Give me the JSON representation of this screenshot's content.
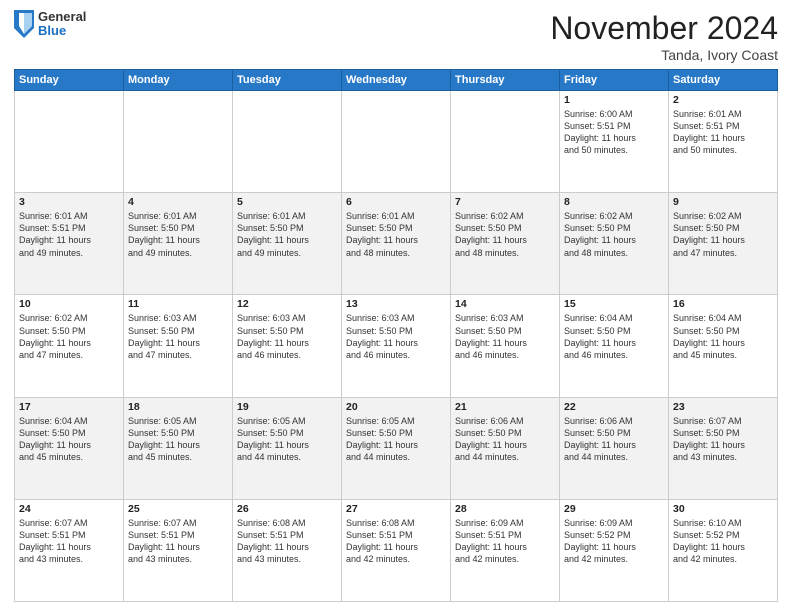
{
  "header": {
    "logo_general": "General",
    "logo_blue": "Blue",
    "month": "November 2024",
    "location": "Tanda, Ivory Coast"
  },
  "weekdays": [
    "Sunday",
    "Monday",
    "Tuesday",
    "Wednesday",
    "Thursday",
    "Friday",
    "Saturday"
  ],
  "weeks": [
    [
      {
        "day": "",
        "info": ""
      },
      {
        "day": "",
        "info": ""
      },
      {
        "day": "",
        "info": ""
      },
      {
        "day": "",
        "info": ""
      },
      {
        "day": "",
        "info": ""
      },
      {
        "day": "1",
        "info": "Sunrise: 6:00 AM\nSunset: 5:51 PM\nDaylight: 11 hours\nand 50 minutes."
      },
      {
        "day": "2",
        "info": "Sunrise: 6:01 AM\nSunset: 5:51 PM\nDaylight: 11 hours\nand 50 minutes."
      }
    ],
    [
      {
        "day": "3",
        "info": "Sunrise: 6:01 AM\nSunset: 5:51 PM\nDaylight: 11 hours\nand 49 minutes."
      },
      {
        "day": "4",
        "info": "Sunrise: 6:01 AM\nSunset: 5:50 PM\nDaylight: 11 hours\nand 49 minutes."
      },
      {
        "day": "5",
        "info": "Sunrise: 6:01 AM\nSunset: 5:50 PM\nDaylight: 11 hours\nand 49 minutes."
      },
      {
        "day": "6",
        "info": "Sunrise: 6:01 AM\nSunset: 5:50 PM\nDaylight: 11 hours\nand 48 minutes."
      },
      {
        "day": "7",
        "info": "Sunrise: 6:02 AM\nSunset: 5:50 PM\nDaylight: 11 hours\nand 48 minutes."
      },
      {
        "day": "8",
        "info": "Sunrise: 6:02 AM\nSunset: 5:50 PM\nDaylight: 11 hours\nand 48 minutes."
      },
      {
        "day": "9",
        "info": "Sunrise: 6:02 AM\nSunset: 5:50 PM\nDaylight: 11 hours\nand 47 minutes."
      }
    ],
    [
      {
        "day": "10",
        "info": "Sunrise: 6:02 AM\nSunset: 5:50 PM\nDaylight: 11 hours\nand 47 minutes."
      },
      {
        "day": "11",
        "info": "Sunrise: 6:03 AM\nSunset: 5:50 PM\nDaylight: 11 hours\nand 47 minutes."
      },
      {
        "day": "12",
        "info": "Sunrise: 6:03 AM\nSunset: 5:50 PM\nDaylight: 11 hours\nand 46 minutes."
      },
      {
        "day": "13",
        "info": "Sunrise: 6:03 AM\nSunset: 5:50 PM\nDaylight: 11 hours\nand 46 minutes."
      },
      {
        "day": "14",
        "info": "Sunrise: 6:03 AM\nSunset: 5:50 PM\nDaylight: 11 hours\nand 46 minutes."
      },
      {
        "day": "15",
        "info": "Sunrise: 6:04 AM\nSunset: 5:50 PM\nDaylight: 11 hours\nand 46 minutes."
      },
      {
        "day": "16",
        "info": "Sunrise: 6:04 AM\nSunset: 5:50 PM\nDaylight: 11 hours\nand 45 minutes."
      }
    ],
    [
      {
        "day": "17",
        "info": "Sunrise: 6:04 AM\nSunset: 5:50 PM\nDaylight: 11 hours\nand 45 minutes."
      },
      {
        "day": "18",
        "info": "Sunrise: 6:05 AM\nSunset: 5:50 PM\nDaylight: 11 hours\nand 45 minutes."
      },
      {
        "day": "19",
        "info": "Sunrise: 6:05 AM\nSunset: 5:50 PM\nDaylight: 11 hours\nand 44 minutes."
      },
      {
        "day": "20",
        "info": "Sunrise: 6:05 AM\nSunset: 5:50 PM\nDaylight: 11 hours\nand 44 minutes."
      },
      {
        "day": "21",
        "info": "Sunrise: 6:06 AM\nSunset: 5:50 PM\nDaylight: 11 hours\nand 44 minutes."
      },
      {
        "day": "22",
        "info": "Sunrise: 6:06 AM\nSunset: 5:50 PM\nDaylight: 11 hours\nand 44 minutes."
      },
      {
        "day": "23",
        "info": "Sunrise: 6:07 AM\nSunset: 5:50 PM\nDaylight: 11 hours\nand 43 minutes."
      }
    ],
    [
      {
        "day": "24",
        "info": "Sunrise: 6:07 AM\nSunset: 5:51 PM\nDaylight: 11 hours\nand 43 minutes."
      },
      {
        "day": "25",
        "info": "Sunrise: 6:07 AM\nSunset: 5:51 PM\nDaylight: 11 hours\nand 43 minutes."
      },
      {
        "day": "26",
        "info": "Sunrise: 6:08 AM\nSunset: 5:51 PM\nDaylight: 11 hours\nand 43 minutes."
      },
      {
        "day": "27",
        "info": "Sunrise: 6:08 AM\nSunset: 5:51 PM\nDaylight: 11 hours\nand 42 minutes."
      },
      {
        "day": "28",
        "info": "Sunrise: 6:09 AM\nSunset: 5:51 PM\nDaylight: 11 hours\nand 42 minutes."
      },
      {
        "day": "29",
        "info": "Sunrise: 6:09 AM\nSunset: 5:52 PM\nDaylight: 11 hours\nand 42 minutes."
      },
      {
        "day": "30",
        "info": "Sunrise: 6:10 AM\nSunset: 5:52 PM\nDaylight: 11 hours\nand 42 minutes."
      }
    ]
  ]
}
